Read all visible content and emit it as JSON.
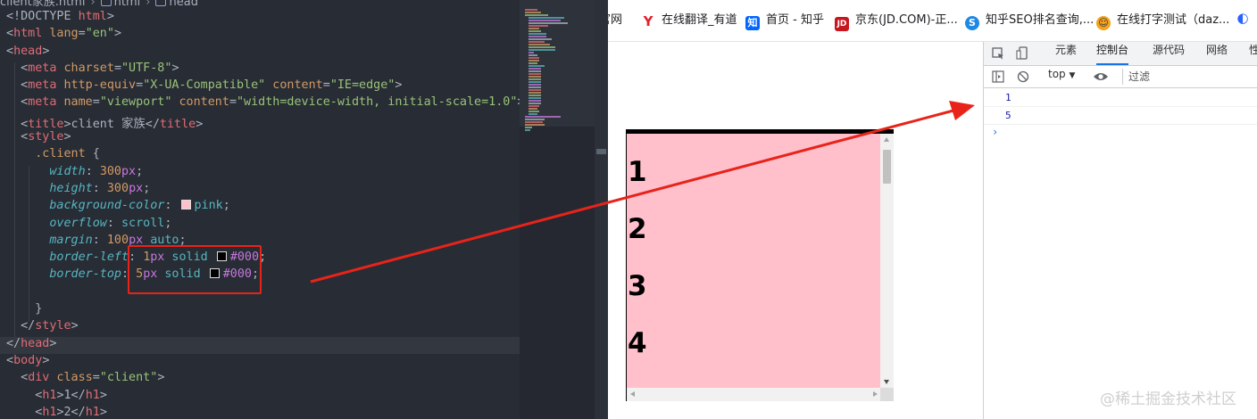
{
  "editor": {
    "breadcrumb": [
      "client家族.html",
      "html",
      "head"
    ]
  },
  "code": {
    "l1": {
      "a": "<!DOCTYPE ",
      "b": "html",
      "c": ">"
    },
    "l2": {
      "a": "<",
      "b": "html",
      "c": " lang",
      "d": "=",
      "e": "\"en\"",
      "f": ">"
    },
    "l3": {
      "a": "<",
      "b": "head",
      "c": ">"
    },
    "l4": {
      "a": "<",
      "b": "meta",
      "c": " charset",
      "d": "=",
      "e": "\"UTF-8\"",
      "f": ">"
    },
    "l5": {
      "a": "<",
      "b": "meta",
      "c": " http-equiv",
      "d": "=",
      "e": "\"X-UA-Compatible\"",
      "f": " content",
      "g": "=",
      "h": "\"IE=edge\"",
      "i": ">"
    },
    "l6": {
      "a": "<",
      "b": "meta",
      "c": " name",
      "d": "=",
      "e": "\"viewport\"",
      "f": " content",
      "g": "=",
      "h": "\"width=device-width, initial-scale=1.0\"",
      "i": ">"
    },
    "l7": {
      "a": "<",
      "b": "title",
      "c": ">client 家族</",
      "d": "title",
      "e": ">"
    },
    "l8": {
      "a": "<",
      "b": "style",
      "c": ">"
    },
    "l9": {
      "a": ".client",
      "b": " {"
    },
    "l10": {
      "a": "width",
      "b": ": ",
      "c": "300",
      "d": "px",
      "e": ";"
    },
    "l11": {
      "a": "height",
      "b": ": ",
      "c": "300",
      "d": "px",
      "e": ";"
    },
    "l12": {
      "a": "background-color",
      "b": ": ",
      "c": "pink",
      "d": ";"
    },
    "l13": {
      "a": "overflow",
      "b": ": ",
      "c": "scroll",
      "d": ";"
    },
    "l14": {
      "a": "margin",
      "b": ": ",
      "c": "100",
      "d": "px",
      "e": " auto",
      "f": ";"
    },
    "l15": {
      "a": "border-left",
      "b": ": ",
      "c": "1",
      "d": "px",
      "e": " solid ",
      "f": "#000",
      "g": ";"
    },
    "l16": {
      "a": "border-top",
      "b": ": ",
      "c": "5",
      "d": "px",
      "e": " solid ",
      "f": "#000",
      "g": ";"
    },
    "l17": "",
    "l18": {
      "a": "}"
    },
    "l19": {
      "a": "</",
      "b": "style",
      "c": ">"
    },
    "l20": {
      "a": "</",
      "b": "head",
      "c": ">"
    },
    "l21": {
      "a": "<",
      "b": "body",
      "c": ">"
    },
    "l22": {
      "a": "<",
      "b": "div",
      "c": " class",
      "d": "=",
      "e": "\"client\"",
      "f": ">"
    },
    "l23": {
      "a": "<",
      "b": "h1",
      "c": ">1</",
      "d": "h1",
      "e": ">"
    },
    "l24": {
      "a": "<",
      "b": "h1",
      "c": ">2</",
      "d": "h1",
      "e": ">"
    }
  },
  "bookmarks": [
    {
      "icon": "globe-icon",
      "label": "官网"
    },
    {
      "icon": "youdao-icon",
      "glyph": "Y",
      "label": "在线翻译_有道"
    },
    {
      "icon": "zhihu-icon",
      "glyph": "知",
      "label": "首页 - 知乎"
    },
    {
      "icon": "jd-icon",
      "glyph": "JD",
      "label": "京东(JD.COM)-正..."
    },
    {
      "icon": "seo-icon",
      "glyph": "S",
      "label": "知乎SEO排名查询,..."
    },
    {
      "icon": "typing-icon",
      "glyph": "☺",
      "label": "在线打字测试（daz..."
    },
    {
      "icon": "bookmark-icon",
      "glyph": "◐",
      "label": ""
    }
  ],
  "page": {
    "headings": [
      "1",
      "2",
      "3",
      "4"
    ]
  },
  "devtools": {
    "tabs": [
      "元素",
      "控制台",
      "源代码",
      "网络",
      "性"
    ],
    "active_tab": "控制台",
    "context": "top",
    "filter_placeholder": "过滤",
    "logs": [
      "1",
      "5"
    ],
    "prompt": "›"
  },
  "watermark": "@稀土掘金技术社区",
  "colors": {
    "annotation": "#e8231a",
    "editor_bg": "#282c34",
    "client_bg": "pink"
  }
}
